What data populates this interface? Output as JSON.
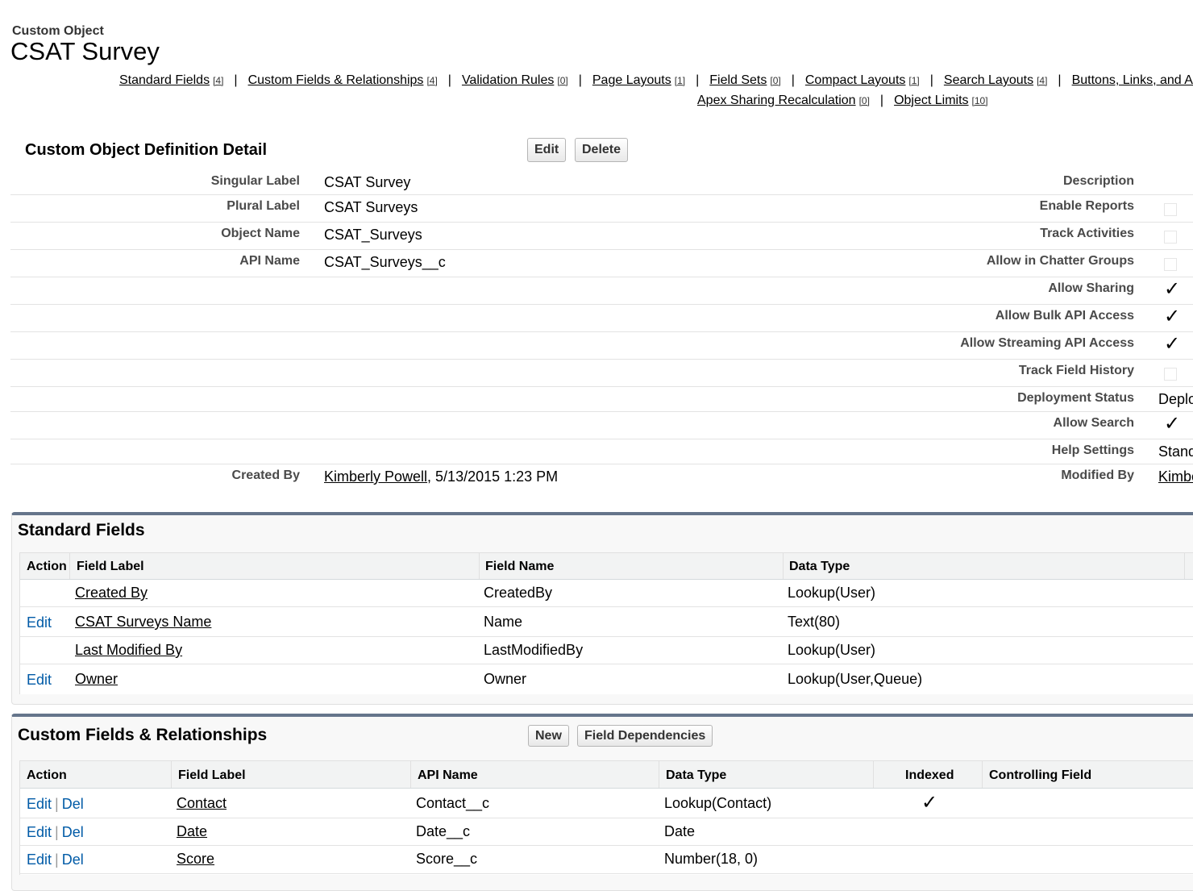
{
  "header": {
    "breadcrumb": "Custom Object",
    "title": "CSAT Survey"
  },
  "related_links": {
    "row1": [
      {
        "label": "Standard Fields",
        "count": "[4]"
      },
      {
        "label": "Custom Fields & Relationships",
        "count": "[4]"
      },
      {
        "label": "Validation Rules",
        "count": "[0]"
      },
      {
        "label": "Page Layouts",
        "count": "[1]"
      },
      {
        "label": "Field Sets",
        "count": "[0]"
      },
      {
        "label": "Compact Layouts",
        "count": "[1]"
      },
      {
        "label": "Search Layouts",
        "count": "[4]"
      },
      {
        "label": "Buttons, Links, and Actions",
        "count": ""
      }
    ],
    "row2": [
      {
        "label": "Apex Sharing Recalculation",
        "count": "[0]"
      },
      {
        "label": "Object Limits",
        "count": "[10]"
      }
    ]
  },
  "definition": {
    "section_title": "Custom Object Definition Detail",
    "edit_label": "Edit",
    "delete_label": "Delete",
    "left_fields": [
      {
        "label": "Singular Label",
        "value": "CSAT Survey"
      },
      {
        "label": "Plural Label",
        "value": "CSAT Surveys"
      },
      {
        "label": "Object Name",
        "value": "CSAT_Surveys"
      },
      {
        "label": "API Name",
        "value": "CSAT_Surveys__c"
      }
    ],
    "created_by_label": "Created By",
    "created_by_user": "Kimberly Powell",
    "created_by_date": ", 5/13/2015 1:23 PM",
    "right_fields": [
      {
        "label": "Description",
        "value": "",
        "kind": "text"
      },
      {
        "label": "Enable Reports",
        "value": "",
        "kind": "checkbox"
      },
      {
        "label": "Track Activities",
        "value": "",
        "kind": "checkbox"
      },
      {
        "label": "Allow in Chatter Groups",
        "value": "",
        "kind": "checkbox"
      },
      {
        "label": "Allow Sharing",
        "value": "✓",
        "kind": "check"
      },
      {
        "label": "Allow Bulk API Access",
        "value": "✓",
        "kind": "check"
      },
      {
        "label": "Allow Streaming API Access",
        "value": "✓",
        "kind": "check"
      },
      {
        "label": "Track Field History",
        "value": "",
        "kind": "checkbox"
      },
      {
        "label": "Deployment Status",
        "value": "Deployed",
        "kind": "text"
      },
      {
        "label": "Allow Search",
        "value": "✓",
        "kind": "check"
      },
      {
        "label": "Help Settings",
        "value": "Standard",
        "kind": "text"
      },
      {
        "label": "Modified By",
        "value": "Kimberly Powell",
        "kind": "link"
      }
    ]
  },
  "standard_fields": {
    "title": "Standard Fields",
    "columns": [
      "Action",
      "Field Label",
      "Field Name",
      "Data Type"
    ],
    "rows": [
      {
        "action": "",
        "label": "Created By",
        "name": "CreatedBy",
        "type": "Lookup(User)"
      },
      {
        "action": "Edit",
        "label": "CSAT Surveys Name",
        "name": "Name",
        "type": "Text(80)"
      },
      {
        "action": "",
        "label": "Last Modified By",
        "name": "LastModifiedBy",
        "type": "Lookup(User)"
      },
      {
        "action": "Edit",
        "label": "Owner",
        "name": "Owner",
        "type": "Lookup(User,Queue)"
      }
    ]
  },
  "custom_fields": {
    "title": "Custom Fields & Relationships",
    "new_label": "New",
    "deps_label": "Field Dependencies",
    "columns": [
      "Action",
      "Field Label",
      "API Name",
      "Data Type",
      "Indexed",
      "Controlling Field"
    ],
    "edit": "Edit",
    "del": "Del",
    "sep": "|",
    "rows": [
      {
        "label": "Contact",
        "api": "Contact__c",
        "type": "Lookup(Contact)",
        "indexed": "✓"
      },
      {
        "label": "Date",
        "api": "Date__c",
        "type": "Date",
        "indexed": ""
      },
      {
        "label": "Score",
        "api": "Score__c",
        "type": "Number(18, 0)",
        "indexed": ""
      }
    ]
  }
}
